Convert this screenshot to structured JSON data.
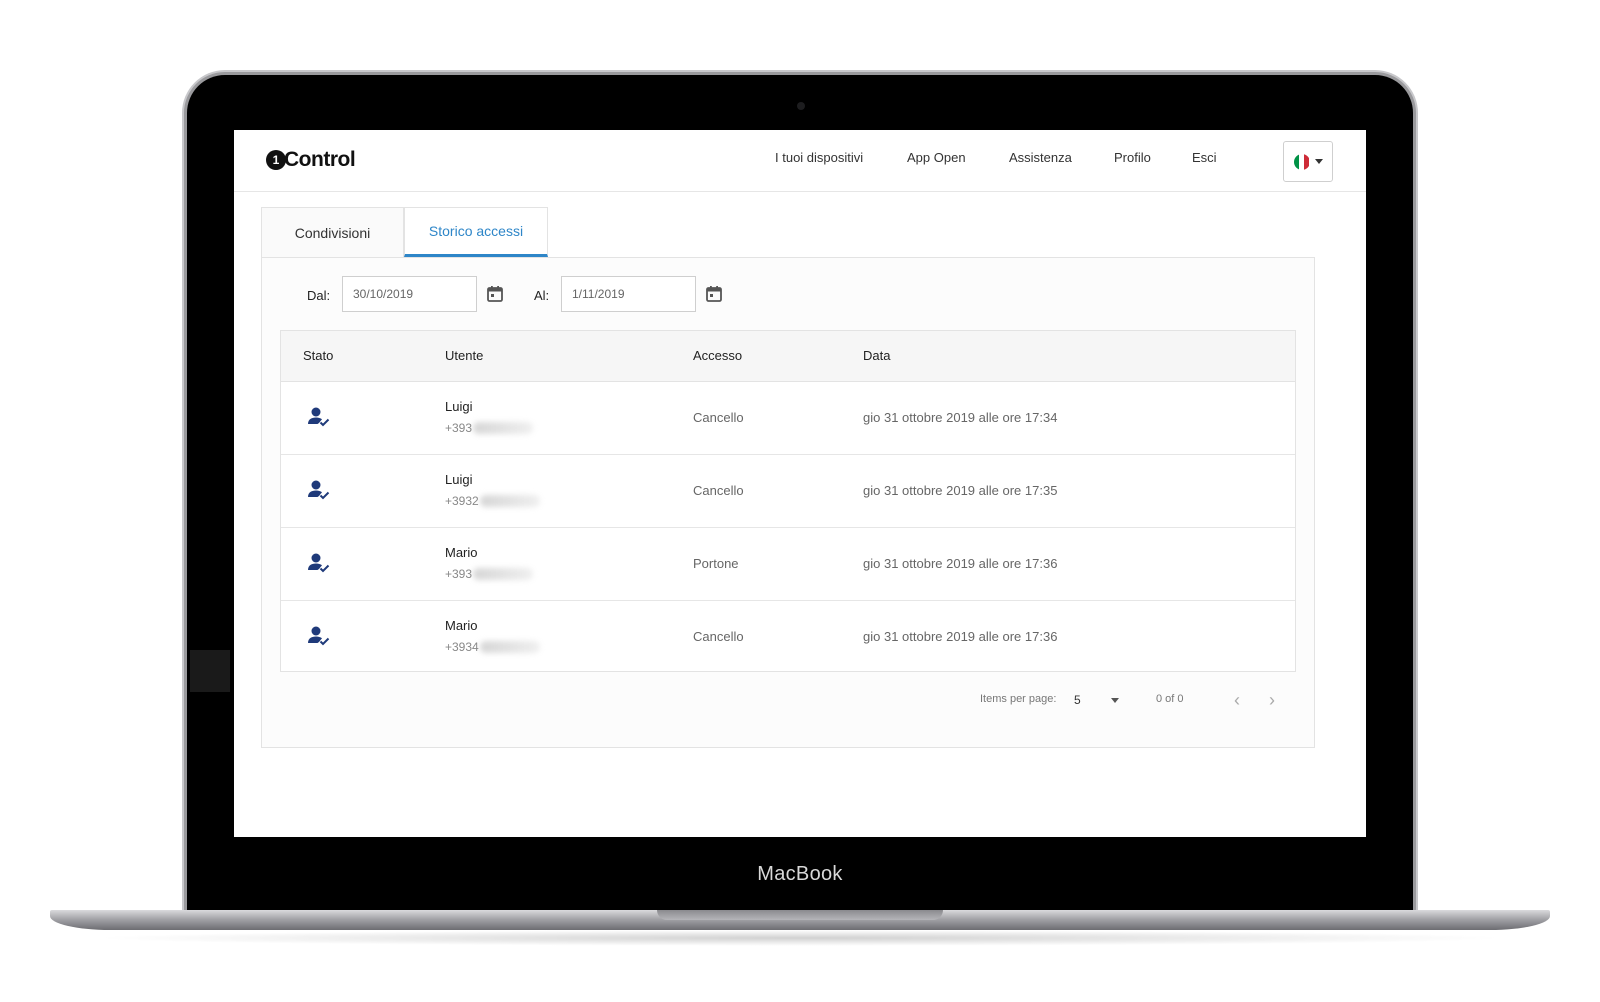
{
  "device": {
    "brand_label": "MacBook"
  },
  "app": {
    "logo_badge": "1",
    "logo_text": "Control",
    "nav": [
      "I tuoi dispositivi",
      "App Open",
      "Assistenza",
      "Profilo",
      "Esci"
    ],
    "language": {
      "flag": "italy-flag-icon",
      "colors": [
        "#009246",
        "#ffffff",
        "#ce2b37"
      ]
    }
  },
  "tabs": {
    "condivisioni": "Condivisioni",
    "storico": "Storico accessi"
  },
  "filters": {
    "from_label": "Dal:",
    "from_value": "30/10/2019",
    "to_label": "Al:",
    "to_value": "1/11/2019"
  },
  "table": {
    "headers": {
      "stato": "Stato",
      "utente": "Utente",
      "accesso": "Accesso",
      "data": "Data"
    },
    "rows": [
      {
        "name": "Luigi",
        "phone": "+393",
        "access": "Cancello",
        "date": "gio 31 ottobre 2019 alle ore 17:34",
        "status_icon": "user-check-icon"
      },
      {
        "name": "Luigi",
        "phone": "+3932",
        "access": "Cancello",
        "date": "gio 31 ottobre 2019 alle ore 17:35",
        "status_icon": "user-check-icon"
      },
      {
        "name": "Mario",
        "phone": "+393",
        "access": "Portone",
        "date": "gio 31 ottobre 2019 alle ore 17:36",
        "status_icon": "user-check-icon"
      },
      {
        "name": "Mario",
        "phone": "+3934",
        "access": "Cancello",
        "date": "gio 31 ottobre 2019 alle ore 17:36",
        "status_icon": "user-check-icon"
      }
    ]
  },
  "pagination": {
    "items_label": "Items per page:",
    "size": "5",
    "range": "0 of 0",
    "prev_icon": "chevron-left-icon",
    "next_icon": "chevron-right-icon"
  },
  "colors": {
    "accent": "#2e86c8",
    "status_icon": "#1f3a7a"
  }
}
